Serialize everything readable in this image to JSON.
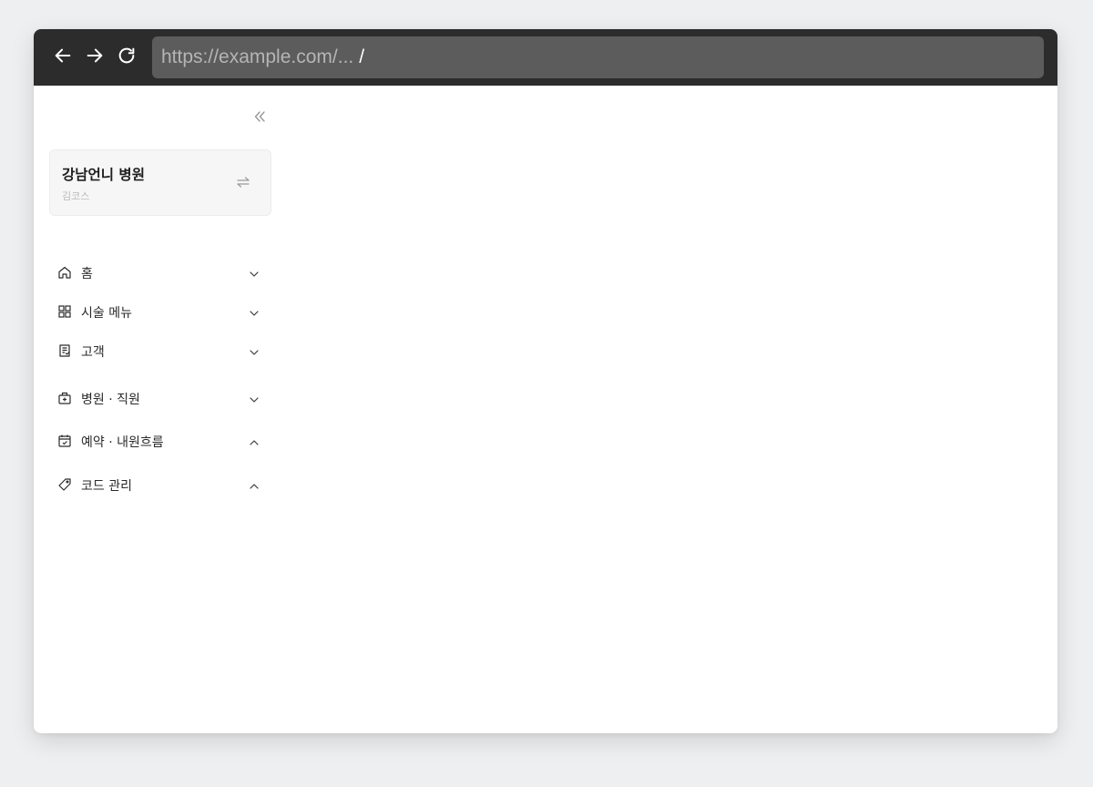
{
  "browser": {
    "url_base": "https://example.com/...",
    "url_path": "/",
    "back_icon": "arrow-left-icon",
    "forward_icon": "arrow-right-icon",
    "reload_icon": "reload-icon"
  },
  "sidebar": {
    "collapse_icon": "chevrons-left-icon",
    "clinic": {
      "name": "강남언니 병원",
      "subtitle": "김코스",
      "switch_icon": "swap-arrows-icon"
    },
    "items": [
      {
        "label": "홈",
        "icon": "home-icon",
        "state": "collapsed"
      },
      {
        "label": "시술 메뉴",
        "icon": "grid-icon",
        "state": "collapsed"
      },
      {
        "label": "고객",
        "icon": "customer-list-icon",
        "state": "collapsed"
      },
      {
        "label": "병원 · 직원",
        "icon": "hospital-icon",
        "state": "collapsed"
      },
      {
        "label": "예약 · 내원흐름",
        "icon": "calendar-icon",
        "state": "expanded"
      },
      {
        "label": "코드 관리",
        "icon": "tag-icon",
        "state": "expanded"
      }
    ]
  },
  "colors": {
    "topbar": "#2c2c2c",
    "urlbar": "#5c5c5c",
    "url_text": "#b5b5b5",
    "card_bg": "#f6f6f7"
  }
}
